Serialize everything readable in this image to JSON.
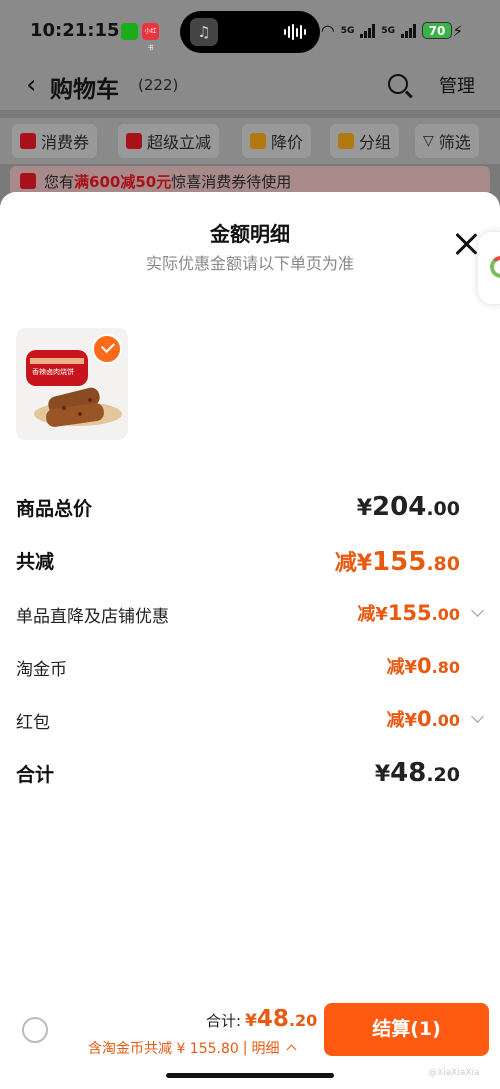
{
  "status_bar": {
    "time": "10:21:15",
    "red_app_badge": "小红书",
    "net1": "5G",
    "net2": "5G",
    "battery": "70"
  },
  "cart": {
    "title": "购物车",
    "count": "(222)",
    "manage": "管理"
  },
  "chips": [
    {
      "label": "消费券"
    },
    {
      "label": "超级立减"
    },
    {
      "label": "降价"
    },
    {
      "label": "分组"
    },
    {
      "label": "筛选"
    }
  ],
  "banner": {
    "prefix": "您有",
    "highlight": "满600减50元",
    "suffix": "惊喜消费券待使用"
  },
  "sheet": {
    "title": "金额明细",
    "subtitle": "实际优惠金额请以下单页为准",
    "product_image_text": "香辣卤肉烧饼",
    "rows": [
      {
        "label": "商品总价",
        "pre": "¥",
        "main": "204",
        "dec": ".00"
      },
      {
        "label": "共减",
        "pre": "减¥",
        "main": "155",
        "dec": ".80"
      },
      {
        "label": "单品直降及店铺优惠",
        "pre": "减¥",
        "main": "155",
        "dec": ".00"
      },
      {
        "label": "淘金币",
        "pre": "减¥",
        "main": "0",
        "dec": ".80"
      },
      {
        "label": "红包",
        "pre": "减¥",
        "main": "0",
        "dec": ".00"
      },
      {
        "label": "合计",
        "pre": "¥",
        "main": "48",
        "dec": ".20"
      }
    ]
  },
  "footer": {
    "total_label": "合计:",
    "total_pre": "¥",
    "total_main": "48",
    "total_dec": ".20",
    "saving_text": "含淘金币共减 ¥ 155.80",
    "separator": "|",
    "detail_label": "明细",
    "checkout_label": "结算(1)",
    "watermark": "@XiaXiaXia"
  },
  "colors": {
    "accent": "#FF5A12",
    "discount_text": "#E65A12",
    "banner_highlight": "#A8101A"
  },
  "icons": [
    "search-icon",
    "close-icon",
    "check-icon",
    "chevron-down-icon",
    "chevron-up-icon",
    "back-arrow-icon",
    "coupon-icon",
    "down-arrow-icon",
    "price-drop-icon",
    "folder-icon",
    "filter-icon"
  ]
}
